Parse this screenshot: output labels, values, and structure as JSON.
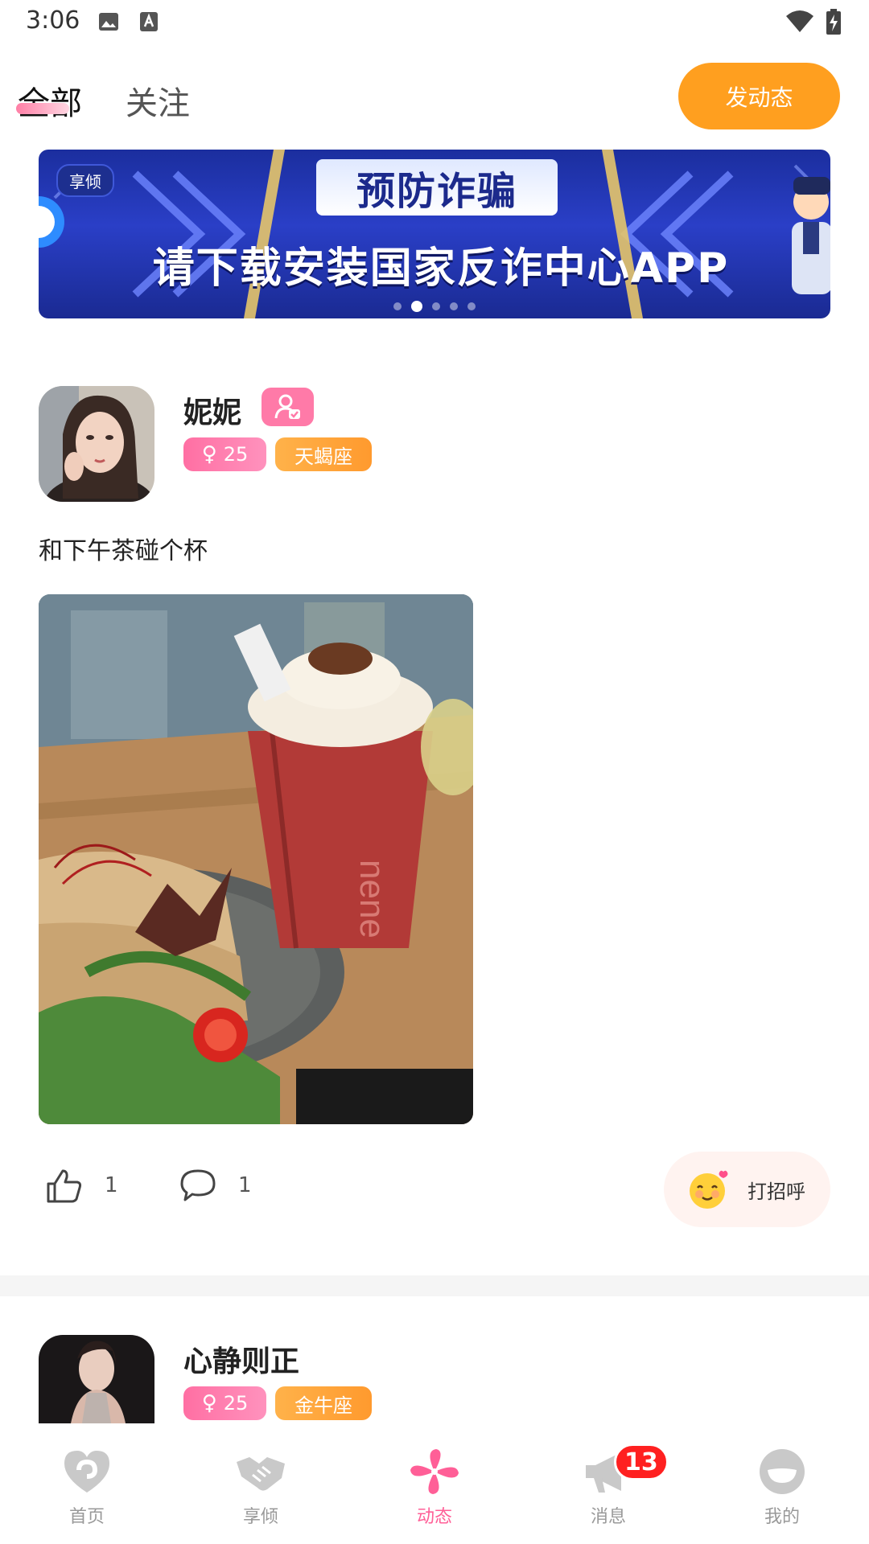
{
  "status_bar": {
    "time": "3:06"
  },
  "header": {
    "tabs": [
      {
        "label": "全部",
        "active": true
      },
      {
        "label": "关注",
        "active": false
      }
    ],
    "post_button": "发动态"
  },
  "banner": {
    "tag": "享倾",
    "title": "预防诈骗",
    "subtitle": "请下载安装国家反诈中心APP",
    "slide_count": 5,
    "active_slide": 2
  },
  "posts": [
    {
      "username": "妮妮",
      "gender_icon": "female-icon",
      "age": "25",
      "zodiac": "天蝎座",
      "text": "和下午茶碰个杯",
      "likes": "1",
      "comments": "1",
      "greet_label": "打招呼"
    },
    {
      "username": "心静则正",
      "gender_icon": "female-icon",
      "age": "25",
      "zodiac": "金牛座"
    }
  ],
  "bottom_nav": {
    "items": [
      {
        "label": "首页",
        "icon": "home-heart-icon",
        "active": false
      },
      {
        "label": "享倾",
        "icon": "handshake-icon",
        "active": false
      },
      {
        "label": "动态",
        "icon": "pinwheel-icon",
        "active": true
      },
      {
        "label": "消息",
        "icon": "megaphone-icon",
        "active": false,
        "badge": "13"
      },
      {
        "label": "我的",
        "icon": "profile-face-icon",
        "active": false
      }
    ]
  },
  "colors": {
    "accent_orange": "#ff9f1f",
    "accent_pink": "#ff5f97",
    "badge_red": "#ff2020"
  }
}
